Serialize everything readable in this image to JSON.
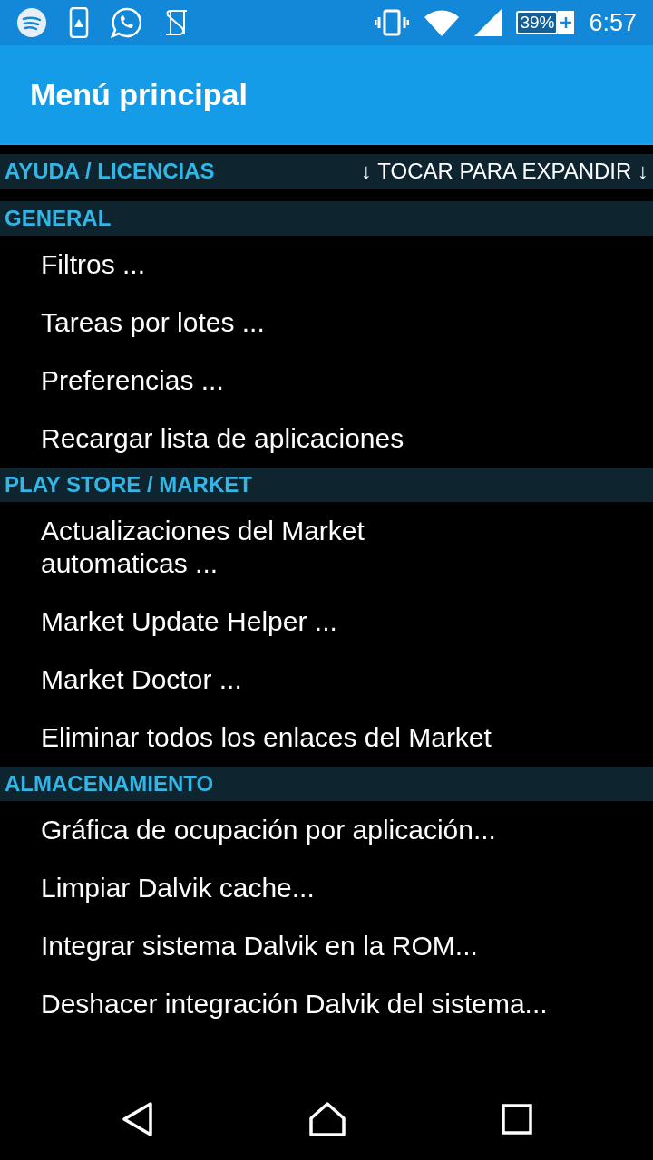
{
  "status_bar": {
    "battery": "39%",
    "time": "6:57"
  },
  "app_bar": {
    "title": "Menú principal"
  },
  "sections": [
    {
      "title": "AYUDA / LICENCIAS",
      "hint": "↓ TOCAR PARA EXPANDIR ↓"
    },
    {
      "title": "GENERAL",
      "items": [
        "Filtros ...",
        "Tareas por lotes ...",
        "Preferencias ...",
        "Recargar lista de aplicaciones"
      ]
    },
    {
      "title": "PLAY STORE / MARKET",
      "items": [
        "Actualizaciones del Market\nautomaticas ...",
        "Market Update Helper ...",
        "Market Doctor ...",
        "Eliminar todos los enlaces del Market"
      ]
    },
    {
      "title": "ALMACENAMIENTO",
      "items": [
        "Gráfica de ocupación por aplicación...",
        "Limpiar Dalvik cache...",
        "Integrar sistema Dalvik en la ROM...",
        "Deshacer integración Dalvik del sistema..."
      ]
    }
  ]
}
